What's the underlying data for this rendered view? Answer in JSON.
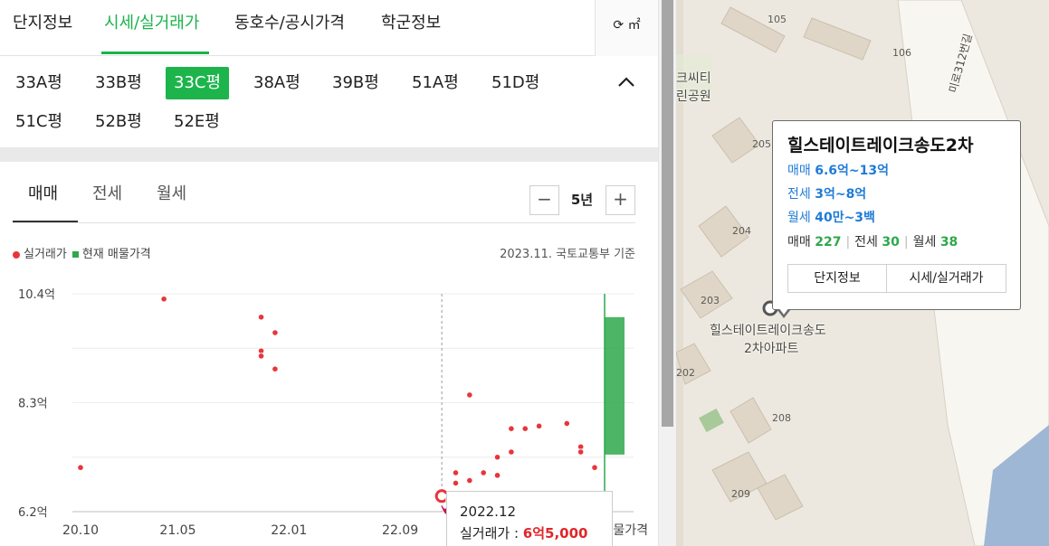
{
  "top_tabs": [
    "단지정보",
    "시세/실거래가",
    "동호수/공시가격",
    "학군정보"
  ],
  "unit_toggle": "㎡",
  "size_options": [
    "33A평",
    "33B평",
    "33C평",
    "38A평",
    "39B평",
    "51A평",
    "51D평",
    "51C평",
    "52B평",
    "52E평"
  ],
  "selected_size": "33C평",
  "deal_tabs": [
    "매매",
    "전세",
    "월세"
  ],
  "period": "5년",
  "legend": {
    "actual": "실거래가",
    "current": "현재 매물가격"
  },
  "source_note": "2023.11. 국토교통부 기준",
  "chart_data": {
    "type": "scatter",
    "y_unit": "억",
    "ylim": [
      6.2,
      10.4
    ],
    "y_ticks": [
      "10.4억",
      "8.3억",
      "6.2억"
    ],
    "x_ticks": [
      "20.10",
      "21.05",
      "22.01",
      "22.09"
    ],
    "x_tick_trailing": "물가격",
    "grid": true,
    "series": [
      {
        "name": "실거래가",
        "color": "#e8353a",
        "points": [
          {
            "x": "2020-10",
            "y": 7.05
          },
          {
            "x": "2021-04",
            "y": 10.3
          },
          {
            "x": "2021-11",
            "y": 9.95
          },
          {
            "x": "2021-11",
            "y": 9.3
          },
          {
            "x": "2021-11",
            "y": 9.2
          },
          {
            "x": "2021-12",
            "y": 9.65
          },
          {
            "x": "2021-12",
            "y": 8.95
          },
          {
            "x": "2022-12",
            "y": 6.5
          },
          {
            "x": "2023-01",
            "y": 6.95
          },
          {
            "x": "2023-01",
            "y": 6.75
          },
          {
            "x": "2023-02",
            "y": 6.8
          },
          {
            "x": "2023-02",
            "y": 8.45
          },
          {
            "x": "2023-03",
            "y": 6.95
          },
          {
            "x": "2023-04",
            "y": 6.9
          },
          {
            "x": "2023-04",
            "y": 7.25
          },
          {
            "x": "2023-05",
            "y": 7.35
          },
          {
            "x": "2023-05",
            "y": 7.8
          },
          {
            "x": "2023-06",
            "y": 7.8
          },
          {
            "x": "2023-07",
            "y": 7.85
          },
          {
            "x": "2023-09",
            "y": 7.9
          },
          {
            "x": "2023-10",
            "y": 7.45
          },
          {
            "x": "2023-10",
            "y": 7.35
          },
          {
            "x": "2023-11",
            "y": 7.05
          }
        ]
      },
      {
        "name": "현재 매물가격",
        "type": "range",
        "color": "#2ea84b",
        "range": [
          7.3,
          9.95
        ]
      }
    ]
  },
  "tooltip": {
    "date": "2022.12",
    "label": "실거래가 : ",
    "price": "6억5,000"
  },
  "map": {
    "labels": [
      "크씨티",
      "린공원",
      "미로312번길",
      "힐스테이트레이크송도",
      "2차아파트"
    ],
    "building_numbers": [
      "105",
      "106",
      "205",
      "204",
      "203",
      "202",
      "208",
      "209"
    ],
    "popup": {
      "title": "힐스테이트레이크송도2차",
      "prices": [
        {
          "label": "매매",
          "value": "6.6억~13억"
        },
        {
          "label": "전세",
          "value": "3억~8억"
        },
        {
          "label": "월세",
          "value": "40만~3백"
        }
      ],
      "counts": [
        {
          "label": "매매",
          "value": "227"
        },
        {
          "label": "전세",
          "value": "30"
        },
        {
          "label": "월세",
          "value": "38"
        }
      ],
      "buttons": [
        "단지정보",
        "시세/실거래가"
      ]
    }
  }
}
